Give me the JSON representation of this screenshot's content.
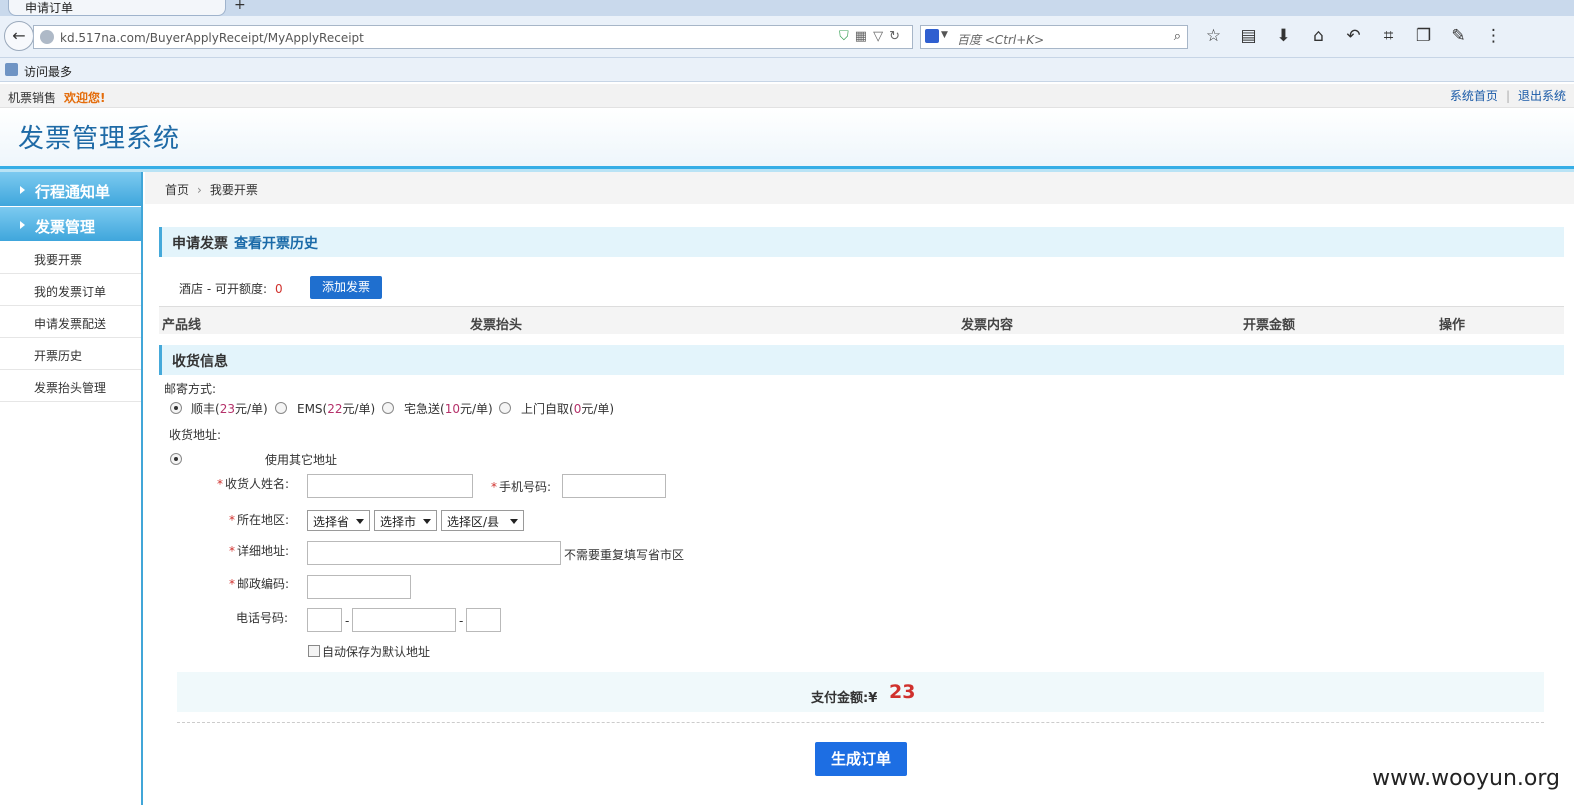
{
  "browser": {
    "tab_title": "申请订单",
    "url": "kd.517na.com/BuyerApplyReceipt/MyApplyReceipt",
    "search_placeholder": "百度 <Ctrl+K>",
    "bookmark_label": "访问最多"
  },
  "header": {
    "site_name": "机票销售",
    "welcome": "欢迎您!",
    "links": [
      "系统首页",
      "退出系统"
    ],
    "title": "发票管理系统"
  },
  "sidebar": {
    "groups": [
      {
        "label": "行程通知单"
      },
      {
        "label": "发票管理"
      }
    ],
    "items": [
      {
        "label": "我要开票"
      },
      {
        "label": "我的发票订单"
      },
      {
        "label": "申请发票配送"
      },
      {
        "label": "开票历史"
      },
      {
        "label": "发票抬头管理"
      }
    ]
  },
  "breadcrumb": {
    "home": "首页",
    "current": "我要开票"
  },
  "apply": {
    "title": "申请发票",
    "history_link": "查看开票历史",
    "quota_label": "酒店 - 可开额度:",
    "quota_value": "0",
    "add_button": "添加发票"
  },
  "table": {
    "headers": [
      "产品线",
      "发票抬头",
      "发票内容",
      "开票金额",
      "操作"
    ]
  },
  "shipping": {
    "title": "收货信息",
    "method_label": "邮寄方式:",
    "options": [
      {
        "name": "顺丰(",
        "price": "23",
        "unit": "元/单)",
        "selected": true
      },
      {
        "name": "EMS(",
        "price": "22",
        "unit": "元/单)",
        "selected": false
      },
      {
        "name": "宅急送(",
        "price": "10",
        "unit": "元/单)",
        "selected": false
      },
      {
        "name": "上门自取(",
        "price": "0",
        "unit": "元/单)",
        "selected": false
      }
    ],
    "address_label": "收货地址:",
    "use_other": "使用其它地址",
    "receiver_name": "收货人姓名:",
    "mobile": "手机号码:",
    "region": "所在地区:",
    "province": "选择省",
    "city": "选择市",
    "district": "选择区/县",
    "detail_address": "详细地址:",
    "detail_hint": "不需要重复填写省市区",
    "postcode": "邮政编码:",
    "phone": "电话号码:",
    "dash": "-",
    "save_default": "自动保存为默认地址"
  },
  "payment": {
    "label": "支付金额:",
    "currency": "¥",
    "amount": "23",
    "submit": "生成订单"
  },
  "watermark": "www.wooyun.org"
}
